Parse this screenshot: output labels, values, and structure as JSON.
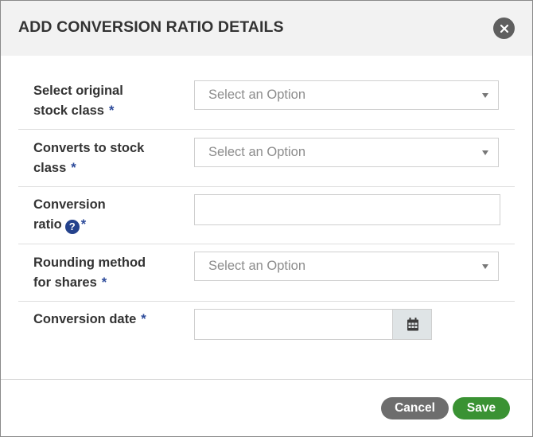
{
  "modal": {
    "title": "ADD CONVERSION RATIO DETAILS"
  },
  "form": {
    "required_marker": "*",
    "help_glyph": "?",
    "original_stock_class": {
      "label_line1": "Select original",
      "label_line2": "stock class",
      "placeholder": "Select an Option"
    },
    "converts_to_stock_class": {
      "label_line1": "Converts to stock",
      "label_line2": "class",
      "placeholder": "Select an Option"
    },
    "conversion_ratio": {
      "label_line1": "Conversion",
      "label_line2": "ratio",
      "value": ""
    },
    "rounding_method": {
      "label_line1": "Rounding method",
      "label_line2": "for shares",
      "placeholder": "Select an Option"
    },
    "conversion_date": {
      "label": "Conversion date",
      "value": ""
    }
  },
  "footer": {
    "cancel_label": "Cancel",
    "save_label": "Save"
  },
  "colors": {
    "header_bg": "#f2f2f2",
    "required_marker": "#2c4a9a",
    "help_icon": "#24428c",
    "cancel_button": "#6d6d6d",
    "save_button": "#3a9233"
  },
  "icons": {
    "close": "close-icon",
    "help": "help-icon",
    "dropdown": "chevron-down-icon",
    "calendar": "calendar-icon"
  }
}
